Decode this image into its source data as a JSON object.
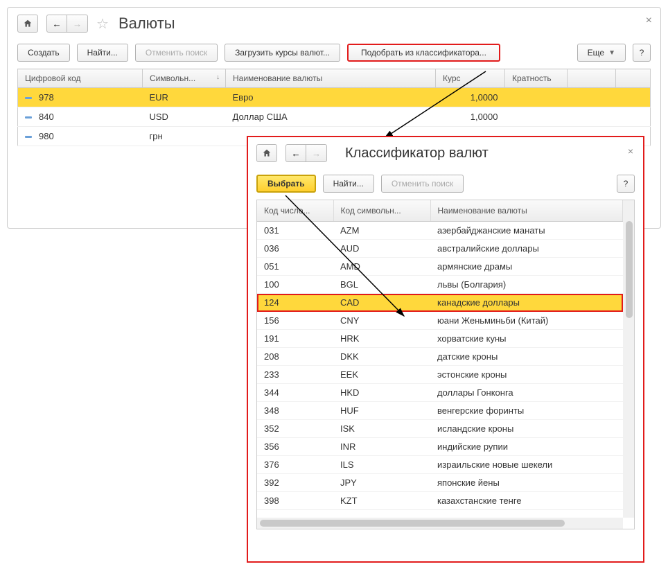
{
  "main": {
    "title": "Валюты",
    "toolbar": {
      "create": "Создать",
      "find": "Найти...",
      "cancel_search": "Отменить поиск",
      "load_rates": "Загрузить курсы валют...",
      "pick_classifier": "Подобрать из классификатора...",
      "more": "Еще",
      "help": "?"
    },
    "columns": {
      "code": "Цифровой код",
      "symbol": "Символьн...",
      "name": "Наименование валюты",
      "rate": "Курс",
      "mult": "Кратность"
    },
    "rows": [
      {
        "code": "978",
        "sym": "EUR",
        "name": "Евро",
        "rate": "1,0000",
        "mult": ""
      },
      {
        "code": "840",
        "sym": "USD",
        "name": "Доллар США",
        "rate": "1,0000",
        "mult": ""
      },
      {
        "code": "980",
        "sym": "грн",
        "name": "",
        "rate": "",
        "mult": ""
      }
    ]
  },
  "popup": {
    "title": "Классификатор валют",
    "toolbar": {
      "select": "Выбрать",
      "find": "Найти...",
      "cancel_search": "Отменить поиск",
      "help": "?"
    },
    "columns": {
      "code": "Код число...",
      "sym": "Код символьн...",
      "name": "Наименование валюты"
    },
    "rows": [
      {
        "code": "031",
        "sym": "AZM",
        "name": "азербайджанские манаты"
      },
      {
        "code": "036",
        "sym": "AUD",
        "name": "австралийские доллары"
      },
      {
        "code": "051",
        "sym": "AMD",
        "name": "армянские драмы"
      },
      {
        "code": "100",
        "sym": "BGL",
        "name": "львы (Болгария)"
      },
      {
        "code": "124",
        "sym": "CAD",
        "name": "канадские доллары"
      },
      {
        "code": "156",
        "sym": "CNY",
        "name": "юани Женьминьби (Китай)"
      },
      {
        "code": "191",
        "sym": "HRK",
        "name": "хорватские куны"
      },
      {
        "code": "208",
        "sym": "DKK",
        "name": "датские кроны"
      },
      {
        "code": "233",
        "sym": "EEK",
        "name": "эстонские кроны"
      },
      {
        "code": "344",
        "sym": "HKD",
        "name": "доллары Гонконга"
      },
      {
        "code": "348",
        "sym": "HUF",
        "name": "венгерские форинты"
      },
      {
        "code": "352",
        "sym": "ISK",
        "name": "исландские кроны"
      },
      {
        "code": "356",
        "sym": "INR",
        "name": "индийские рупии"
      },
      {
        "code": "376",
        "sym": "ILS",
        "name": "израильские новые шекели"
      },
      {
        "code": "392",
        "sym": "JPY",
        "name": "японские йены"
      },
      {
        "code": "398",
        "sym": "KZT",
        "name": "казахстанские тенге"
      }
    ],
    "selected_index": 4
  }
}
